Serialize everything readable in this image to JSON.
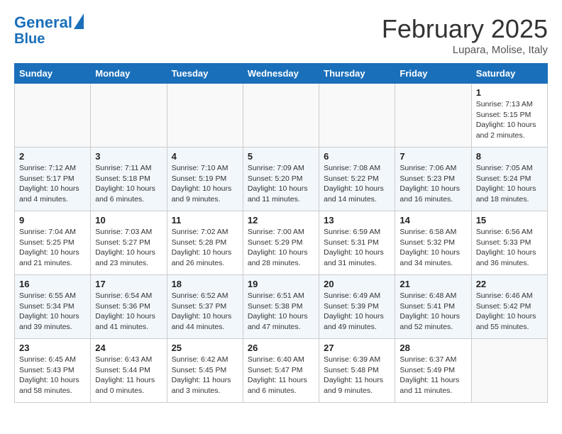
{
  "header": {
    "logo_line1": "General",
    "logo_line2": "Blue",
    "month": "February 2025",
    "location": "Lupara, Molise, Italy"
  },
  "weekdays": [
    "Sunday",
    "Monday",
    "Tuesday",
    "Wednesday",
    "Thursday",
    "Friday",
    "Saturday"
  ],
  "weeks": [
    [
      {
        "day": "",
        "info": ""
      },
      {
        "day": "",
        "info": ""
      },
      {
        "day": "",
        "info": ""
      },
      {
        "day": "",
        "info": ""
      },
      {
        "day": "",
        "info": ""
      },
      {
        "day": "",
        "info": ""
      },
      {
        "day": "1",
        "info": "Sunrise: 7:13 AM\nSunset: 5:15 PM\nDaylight: 10 hours\nand 2 minutes."
      }
    ],
    [
      {
        "day": "2",
        "info": "Sunrise: 7:12 AM\nSunset: 5:17 PM\nDaylight: 10 hours\nand 4 minutes."
      },
      {
        "day": "3",
        "info": "Sunrise: 7:11 AM\nSunset: 5:18 PM\nDaylight: 10 hours\nand 6 minutes."
      },
      {
        "day": "4",
        "info": "Sunrise: 7:10 AM\nSunset: 5:19 PM\nDaylight: 10 hours\nand 9 minutes."
      },
      {
        "day": "5",
        "info": "Sunrise: 7:09 AM\nSunset: 5:20 PM\nDaylight: 10 hours\nand 11 minutes."
      },
      {
        "day": "6",
        "info": "Sunrise: 7:08 AM\nSunset: 5:22 PM\nDaylight: 10 hours\nand 14 minutes."
      },
      {
        "day": "7",
        "info": "Sunrise: 7:06 AM\nSunset: 5:23 PM\nDaylight: 10 hours\nand 16 minutes."
      },
      {
        "day": "8",
        "info": "Sunrise: 7:05 AM\nSunset: 5:24 PM\nDaylight: 10 hours\nand 18 minutes."
      }
    ],
    [
      {
        "day": "9",
        "info": "Sunrise: 7:04 AM\nSunset: 5:25 PM\nDaylight: 10 hours\nand 21 minutes."
      },
      {
        "day": "10",
        "info": "Sunrise: 7:03 AM\nSunset: 5:27 PM\nDaylight: 10 hours\nand 23 minutes."
      },
      {
        "day": "11",
        "info": "Sunrise: 7:02 AM\nSunset: 5:28 PM\nDaylight: 10 hours\nand 26 minutes."
      },
      {
        "day": "12",
        "info": "Sunrise: 7:00 AM\nSunset: 5:29 PM\nDaylight: 10 hours\nand 28 minutes."
      },
      {
        "day": "13",
        "info": "Sunrise: 6:59 AM\nSunset: 5:31 PM\nDaylight: 10 hours\nand 31 minutes."
      },
      {
        "day": "14",
        "info": "Sunrise: 6:58 AM\nSunset: 5:32 PM\nDaylight: 10 hours\nand 34 minutes."
      },
      {
        "day": "15",
        "info": "Sunrise: 6:56 AM\nSunset: 5:33 PM\nDaylight: 10 hours\nand 36 minutes."
      }
    ],
    [
      {
        "day": "16",
        "info": "Sunrise: 6:55 AM\nSunset: 5:34 PM\nDaylight: 10 hours\nand 39 minutes."
      },
      {
        "day": "17",
        "info": "Sunrise: 6:54 AM\nSunset: 5:36 PM\nDaylight: 10 hours\nand 41 minutes."
      },
      {
        "day": "18",
        "info": "Sunrise: 6:52 AM\nSunset: 5:37 PM\nDaylight: 10 hours\nand 44 minutes."
      },
      {
        "day": "19",
        "info": "Sunrise: 6:51 AM\nSunset: 5:38 PM\nDaylight: 10 hours\nand 47 minutes."
      },
      {
        "day": "20",
        "info": "Sunrise: 6:49 AM\nSunset: 5:39 PM\nDaylight: 10 hours\nand 49 minutes."
      },
      {
        "day": "21",
        "info": "Sunrise: 6:48 AM\nSunset: 5:41 PM\nDaylight: 10 hours\nand 52 minutes."
      },
      {
        "day": "22",
        "info": "Sunrise: 6:46 AM\nSunset: 5:42 PM\nDaylight: 10 hours\nand 55 minutes."
      }
    ],
    [
      {
        "day": "23",
        "info": "Sunrise: 6:45 AM\nSunset: 5:43 PM\nDaylight: 10 hours\nand 58 minutes."
      },
      {
        "day": "24",
        "info": "Sunrise: 6:43 AM\nSunset: 5:44 PM\nDaylight: 11 hours\nand 0 minutes."
      },
      {
        "day": "25",
        "info": "Sunrise: 6:42 AM\nSunset: 5:45 PM\nDaylight: 11 hours\nand 3 minutes."
      },
      {
        "day": "26",
        "info": "Sunrise: 6:40 AM\nSunset: 5:47 PM\nDaylight: 11 hours\nand 6 minutes."
      },
      {
        "day": "27",
        "info": "Sunrise: 6:39 AM\nSunset: 5:48 PM\nDaylight: 11 hours\nand 9 minutes."
      },
      {
        "day": "28",
        "info": "Sunrise: 6:37 AM\nSunset: 5:49 PM\nDaylight: 11 hours\nand 11 minutes."
      },
      {
        "day": "",
        "info": ""
      }
    ]
  ]
}
